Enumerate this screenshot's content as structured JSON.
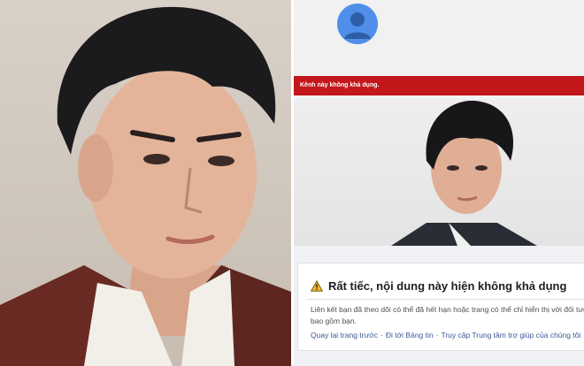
{
  "youtube": {
    "banner_text": "Kênh này không khả dụng."
  },
  "facebook_error": {
    "title": "Rất tiếc, nội dung này hiện không khả dụng",
    "body_line1": "Liên kết bạn đã theo dõi có thể đã hết hạn hoặc trang có thể chỉ hiển thị với đối tượng",
    "body_line2": "bao gồm bạn.",
    "links": [
      {
        "label": "Quay lại trang trước"
      },
      {
        "label": "Đi tới Bảng tin"
      },
      {
        "label": "Truy cập Trung tâm trợ giúp của chúng tôi"
      }
    ]
  },
  "colors": {
    "banner_red": "#c4171b",
    "avatar_blue": "#4f8fea",
    "link_blue": "#385898",
    "warning_yellow": "#f7b928"
  }
}
